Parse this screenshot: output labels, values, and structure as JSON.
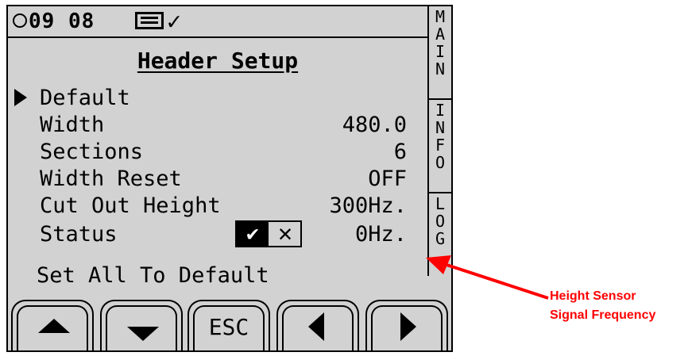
{
  "status_bar": {
    "clock": "09 08",
    "clock_icon": "clock-icon",
    "doc_icon": "document-icon",
    "check_icon": "checkmark-icon"
  },
  "tabs": [
    "MAIN",
    "INFO",
    "LOG"
  ],
  "title": "Header Setup",
  "menu": {
    "default_label": "Default",
    "width_label": "Width",
    "width_value": "480.0",
    "sections_label": "Sections",
    "sections_value": "6",
    "width_reset_label": "Width Reset",
    "width_reset_value": "OFF",
    "cut_out_height_label": "Cut Out Height",
    "cut_out_height_value": "300Hz.",
    "status_label": "Status",
    "status_value": "0Hz.",
    "status_check": "✔",
    "status_x": "✕",
    "set_all_label": "Set All To Default"
  },
  "softkeys": {
    "esc_label": "ESC"
  },
  "annotation": {
    "line1": "Height Sensor",
    "line2": "Signal Frequency",
    "color": "#ff0000"
  }
}
